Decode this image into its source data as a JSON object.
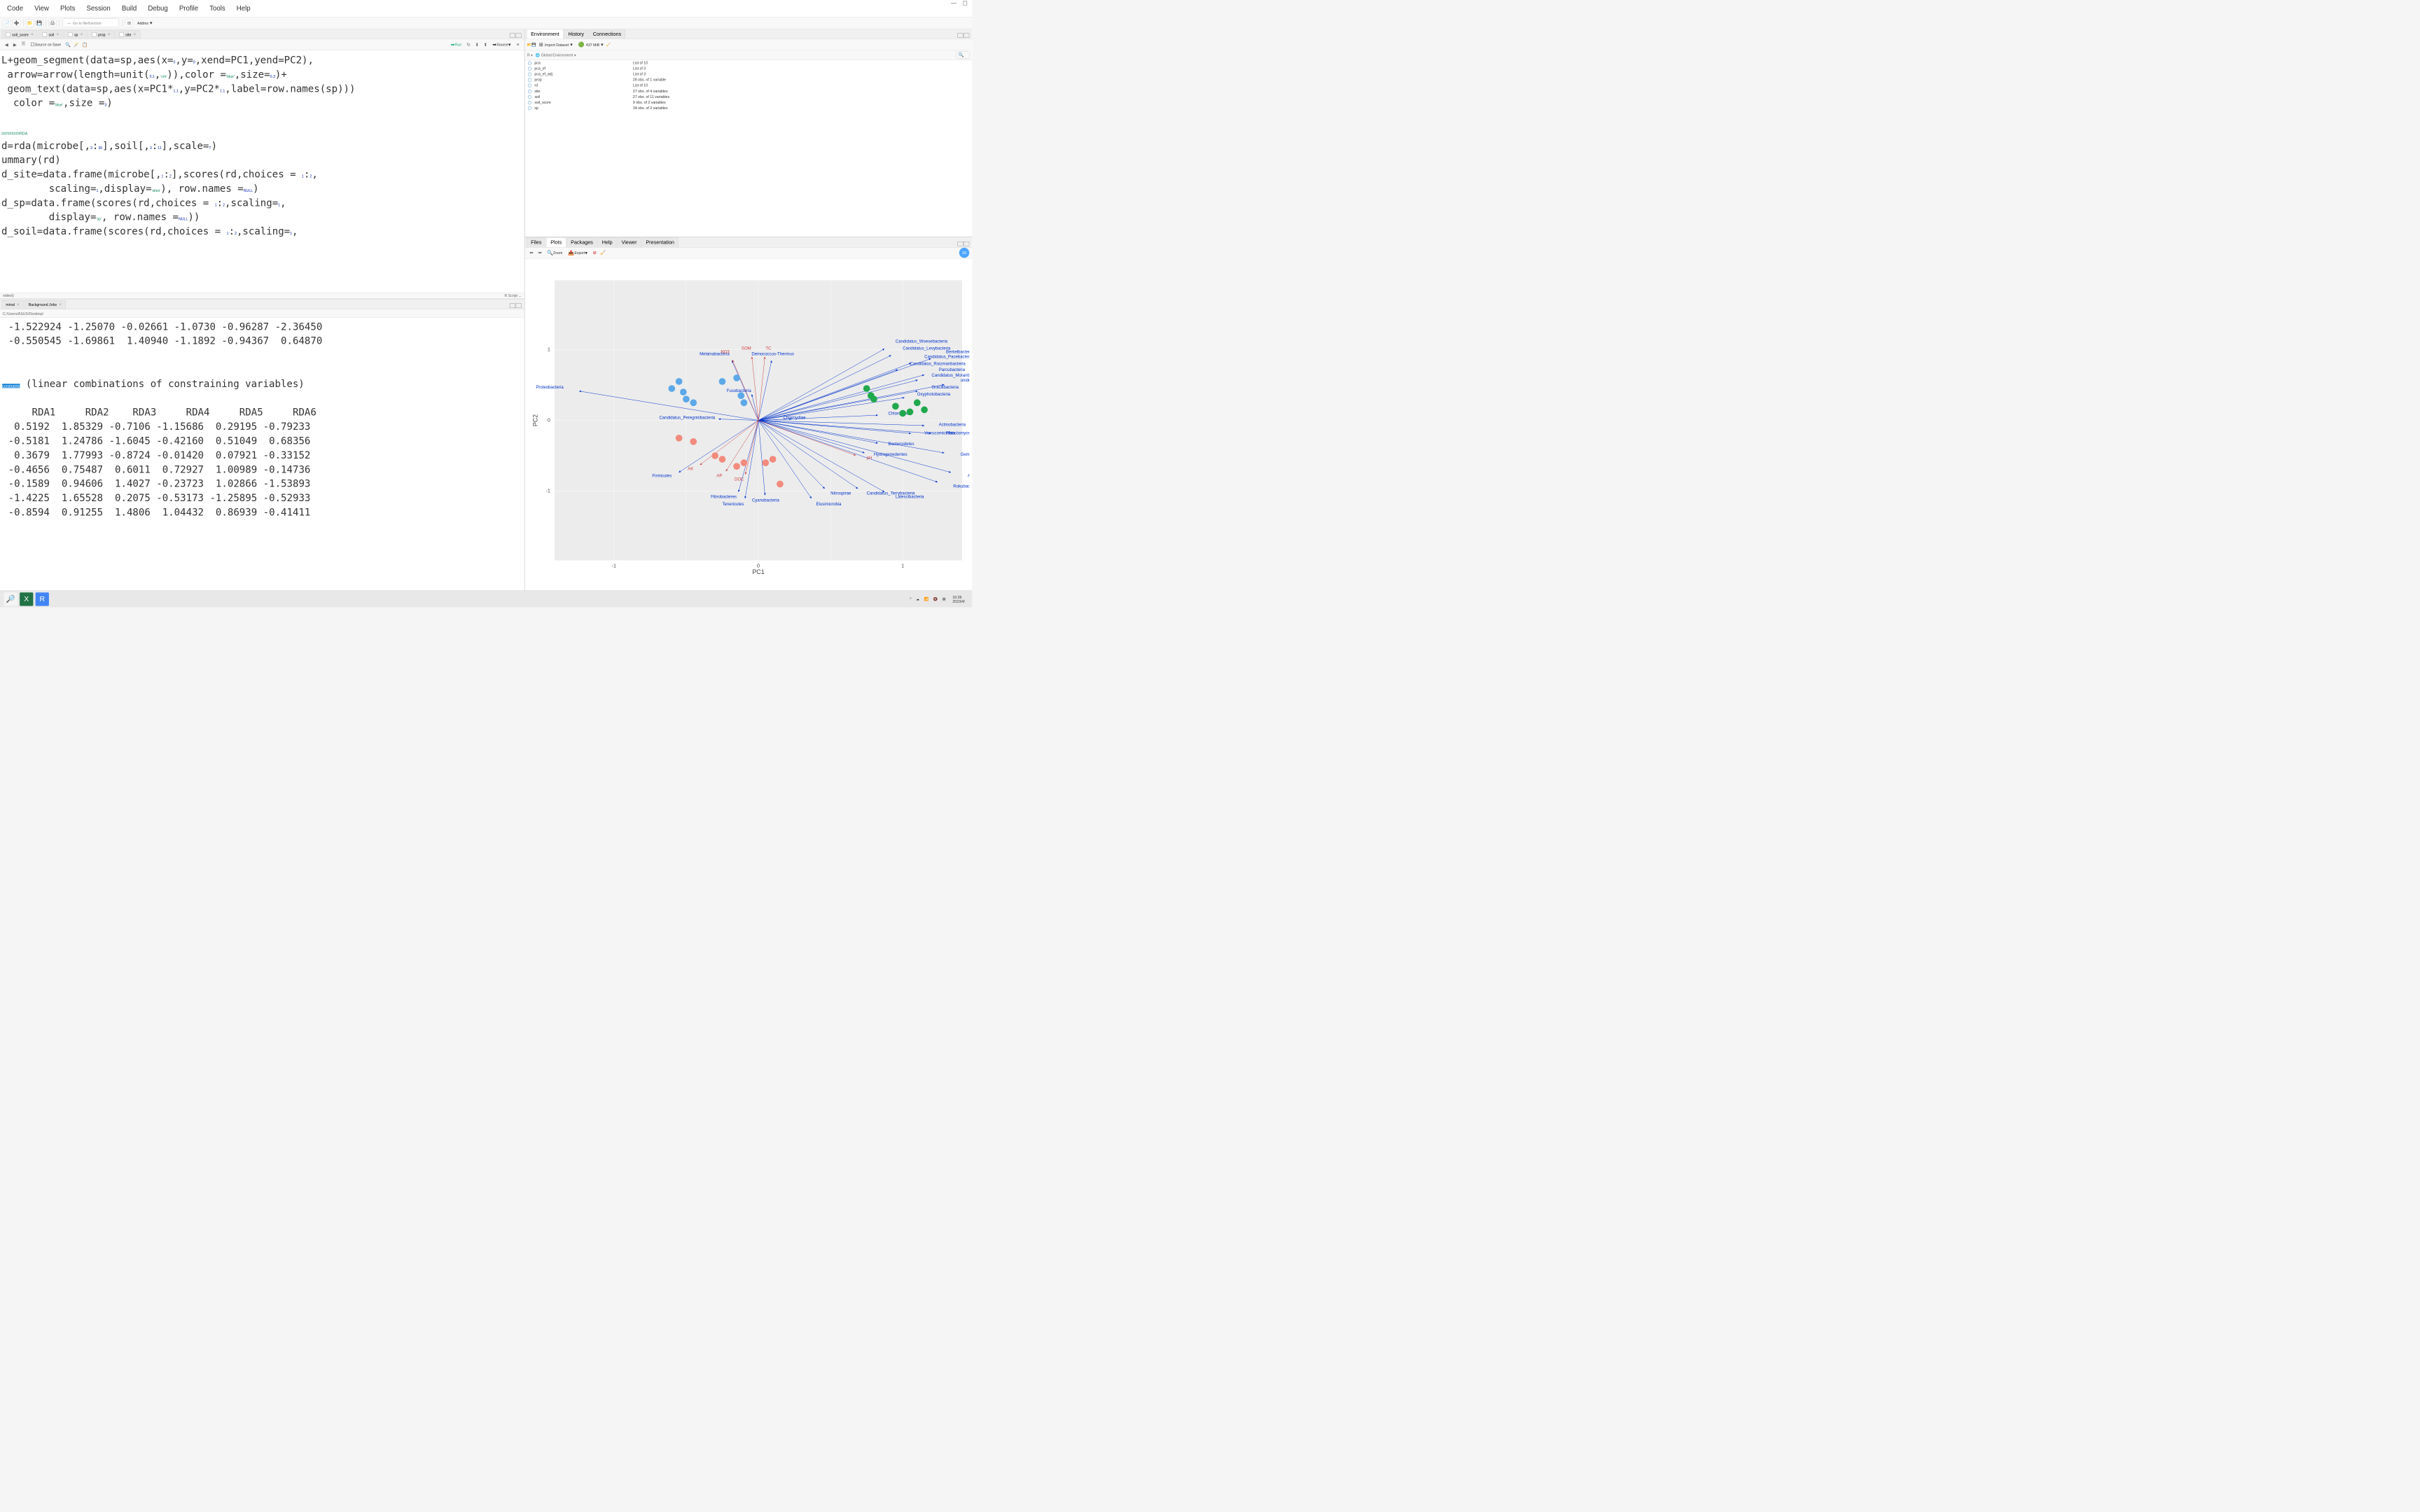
{
  "menu": [
    "Code",
    "View",
    "Plots",
    "Session",
    "Build",
    "Debug",
    "Profile",
    "Tools",
    "Help"
  ],
  "toolbar": {
    "goto_placeholder": "Go to file/function",
    "addins": "Addins"
  },
  "source": {
    "tabs": [
      {
        "label": "soil_score",
        "type": "table"
      },
      {
        "label": "soil",
        "type": "table"
      },
      {
        "label": "sp",
        "type": "table"
      },
      {
        "label": "prop",
        "type": "table"
      },
      {
        "label": "site",
        "type": "table"
      }
    ],
    "source_on_save": "Source on Save",
    "run": "Run",
    "source_btn": "Source",
    "code_lines": [
      "L+geom_segment(data=sp,aes(x=0,y=0,xend=PC1,yend=PC2),",
      " arrow=arrow(length=unit(0.1,'cm')),color ='blue',size=0.3)+",
      " geom_text(data=sp,aes(x=PC1*1.1,y=PC2*1.1,label=row.names(sp)))",
      "  color ='blue',size =3)",
      "",
      "#########RDA",
      "d=rda(microbe[,3:36],soil[,3:11],scale=T)",
      "ummary(rd)",
      "d_site=data.frame(microbe[,1:2],scores(rd,choices = 1:2,",
      "        scaling=1,display='sites'), row.names =NULL)",
      "d_sp=data.frame(scores(rd,choices = 1:2,scaling=1,",
      "        display='sp', row.names =NULL))",
      "d_soil=data.frame(scores(rd,choices = 1:2,scaling=1,"
    ],
    "status_left": "ntitled)",
    "status_right": "R Script"
  },
  "console": {
    "tabs": [
      "minal",
      "Background Jobs"
    ],
    "path": "C:/Users/ASUS/Desktop/",
    "lines": [
      " -1.522924 -1.25070 -0.02661 -1.0730 -0.96287 -2.36450",
      " -0.550545 -1.69861  1.40940 -1.1892 -0.94367  0.64870",
      "",
      "",
      "constraints (linear combinations of constraining variables)",
      "",
      "     RDA1     RDA2    RDA3     RDA4     RDA5     RDA6",
      "  0.5192  1.85329 -0.7106 -1.15686  0.29195 -0.79233",
      " -0.5181  1.24786 -1.6045 -0.42160  0.51049  0.68356",
      "  0.3679  1.77993 -0.8724 -0.01420  0.07921 -0.33152",
      " -0.4656  0.75487  0.6011  0.72927  1.00989 -0.14736",
      " -0.1589  0.94606  1.4027 -0.23723  1.02866 -1.53893",
      " -1.4225  1.65528  0.2075 -0.53173 -1.25895 -0.52933",
      " -0.8594  0.91255  1.4806  1.04432  0.86939 -0.41411"
    ],
    "highlight_token": "constraints",
    "highlight_rest": " (linear combinations of constraining variables)"
  },
  "environment": {
    "tabs": [
      "Environment",
      "History",
      "Connections"
    ],
    "import": "Import Dataset",
    "memory": "437 MiB",
    "scope_r": "R",
    "scope_env": "Global Environment",
    "items": [
      {
        "name": "pca",
        "value": "List of  10"
      },
      {
        "name": "pca_ef",
        "value": "List of  3"
      },
      {
        "name": "pca_ef_adj",
        "value": "List of  3"
      },
      {
        "name": "prop",
        "value": "26 obs. of 1 variable"
      },
      {
        "name": "rd",
        "value": "List of  10"
      },
      {
        "name": "site",
        "value": "27 obs. of 4 variables"
      },
      {
        "name": "soil",
        "value": "27 obs. of 11 variables"
      },
      {
        "name": "soil_score",
        "value": "9 obs. of 2 variables"
      },
      {
        "name": "sp",
        "value": "34 obs. of 2 variables"
      }
    ]
  },
  "plots": {
    "tabs": [
      "Files",
      "Plots",
      "Packages",
      "Help",
      "Viewer",
      "Presentation"
    ],
    "zoom": "Zoom",
    "export": "Export",
    "xlabel": "PC1",
    "ylabel": "PC2",
    "xticks": [
      "-1",
      "0",
      "1"
    ],
    "yticks": [
      "-1",
      "0",
      "1"
    ]
  },
  "chart_data": {
    "type": "scatter",
    "title": "",
    "xlabel": "PC1",
    "ylabel": "PC2",
    "xlim": [
      -1.5,
      1.6
    ],
    "ylim": [
      -1.3,
      1.3
    ],
    "points": [
      {
        "x": -0.55,
        "y": 0.55,
        "group": "blue"
      },
      {
        "x": -0.6,
        "y": 0.45,
        "group": "blue"
      },
      {
        "x": -0.52,
        "y": 0.4,
        "group": "blue"
      },
      {
        "x": -0.5,
        "y": 0.3,
        "group": "blue"
      },
      {
        "x": -0.45,
        "y": 0.25,
        "group": "blue"
      },
      {
        "x": -0.25,
        "y": 0.55,
        "group": "blue"
      },
      {
        "x": -0.15,
        "y": 0.6,
        "group": "blue"
      },
      {
        "x": -0.12,
        "y": 0.35,
        "group": "blue"
      },
      {
        "x": -0.1,
        "y": 0.25,
        "group": "blue"
      },
      {
        "x": 0.75,
        "y": 0.45,
        "group": "green"
      },
      {
        "x": 0.78,
        "y": 0.35,
        "group": "green"
      },
      {
        "x": 0.8,
        "y": 0.3,
        "group": "green"
      },
      {
        "x": 0.95,
        "y": 0.2,
        "group": "green"
      },
      {
        "x": 1.0,
        "y": 0.1,
        "group": "green"
      },
      {
        "x": 1.05,
        "y": 0.12,
        "group": "green"
      },
      {
        "x": 1.1,
        "y": 0.25,
        "group": "green"
      },
      {
        "x": 1.15,
        "y": 0.15,
        "group": "green"
      },
      {
        "x": -0.55,
        "y": -0.25,
        "group": "salmon"
      },
      {
        "x": -0.45,
        "y": -0.3,
        "group": "salmon"
      },
      {
        "x": -0.3,
        "y": -0.5,
        "group": "salmon"
      },
      {
        "x": -0.25,
        "y": -0.55,
        "group": "salmon"
      },
      {
        "x": -0.15,
        "y": -0.65,
        "group": "salmon"
      },
      {
        "x": -0.1,
        "y": -0.6,
        "group": "salmon"
      },
      {
        "x": 0.05,
        "y": -0.6,
        "group": "salmon"
      },
      {
        "x": 0.1,
        "y": -0.55,
        "group": "salmon"
      },
      {
        "x": 0.15,
        "y": -0.9,
        "group": "salmon"
      }
    ],
    "arrows_blue": [
      {
        "label": "Proteobacteria",
        "x": -1.35,
        "y": 0.45
      },
      {
        "label": "Fusobacteria",
        "x": -0.05,
        "y": 0.4
      },
      {
        "label": "Melainabacteria",
        "x": -0.2,
        "y": 0.92
      },
      {
        "label": "Deinococcus-Thermus",
        "x": 0.1,
        "y": 0.92
      },
      {
        "label": "Candidatus_Woesebacteria",
        "x": 0.95,
        "y": 1.1
      },
      {
        "label": "Candidatus_Levybacteria",
        "x": 1.0,
        "y": 1.0
      },
      {
        "label": "Berkelbacteria",
        "x": 1.3,
        "y": 0.95
      },
      {
        "label": "Candidatus_Pacebacteria",
        "x": 1.15,
        "y": 0.88
      },
      {
        "label": "Candidatus_Roizmanbacteria",
        "x": 1.05,
        "y": 0.78
      },
      {
        "label": "Parcubacteria",
        "x": 1.25,
        "y": 0.7
      },
      {
        "label": "Candidatus_Moranbacteria",
        "x": 1.2,
        "y": 0.62
      },
      {
        "label": "unidentified_Bacteria",
        "x": 1.4,
        "y": 0.55
      },
      {
        "label": "Gracilibacteria",
        "x": 1.2,
        "y": 0.45
      },
      {
        "label": "Oxyphotobacteria",
        "x": 1.1,
        "y": 0.35
      },
      {
        "label": "Chloroflexi",
        "x": 0.9,
        "y": 0.08
      },
      {
        "label": "Actinobacteria",
        "x": 1.25,
        "y": -0.08
      },
      {
        "label": "Verrucomicrobia",
        "x": 1.15,
        "y": -0.2
      },
      {
        "label": "Planctomycetes",
        "x": 1.3,
        "y": -0.2
      },
      {
        "label": "Bacteroidetes",
        "x": 0.9,
        "y": -0.35
      },
      {
        "label": "Hydrogenedentes",
        "x": 0.8,
        "y": -0.5
      },
      {
        "label": "Gemmatimonadetes",
        "x": 1.4,
        "y": -0.5
      },
      {
        "label": "Acidobacteria",
        "x": 1.45,
        "y": -0.8
      },
      {
        "label": "Rokubacteria",
        "x": 1.35,
        "y": -0.95
      },
      {
        "label": "Candidatus_Terrybacteria",
        "x": 0.75,
        "y": -1.05
      },
      {
        "label": "Latescibacteria",
        "x": 0.95,
        "y": -1.1
      },
      {
        "label": "Nitrospirae",
        "x": 0.5,
        "y": -1.05
      },
      {
        "label": "Candidatus_Peregrinibacteria",
        "x": -0.3,
        "y": 0.02
      },
      {
        "label": "Chlamydiae",
        "x": 0.25,
        "y": 0.02
      },
      {
        "label": "Firmicutes",
        "x": -0.6,
        "y": -0.8
      },
      {
        "label": "Fibrobacteres",
        "x": -0.15,
        "y": -1.1
      },
      {
        "label": "Cyanobacteria",
        "x": 0.05,
        "y": -1.15
      },
      {
        "label": "Tenericutes",
        "x": -0.1,
        "y": -1.2
      },
      {
        "label": "Elusimicrobia",
        "x": 0.4,
        "y": -1.2
      }
    ],
    "arrows_red": [
      {
        "label": "NO3",
        "x": -0.2,
        "y": 0.95
      },
      {
        "label": "SOM",
        "x": -0.05,
        "y": 1.0
      },
      {
        "label": "TC",
        "x": 0.05,
        "y": 1.0
      },
      {
        "label": "AK",
        "x": -0.45,
        "y": -0.7
      },
      {
        "label": "AP",
        "x": -0.25,
        "y": -0.8
      },
      {
        "label": "DOC",
        "x": -0.1,
        "y": -0.85
      },
      {
        "label": "pH",
        "x": 0.75,
        "y": -0.55
      }
    ]
  },
  "taskbar": {
    "ime": "英",
    "time": "10:36",
    "date": "2023/4/"
  }
}
